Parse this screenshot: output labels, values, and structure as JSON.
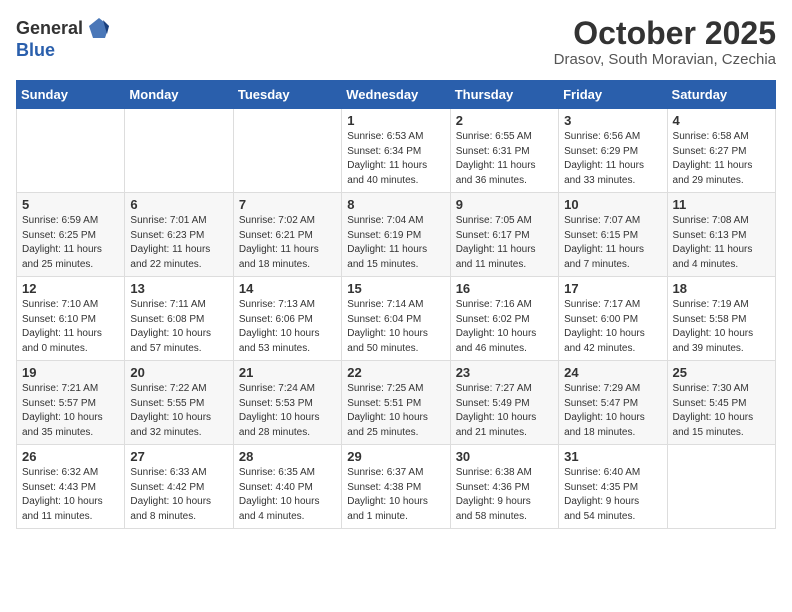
{
  "header": {
    "logo_general": "General",
    "logo_blue": "Blue",
    "month_title": "October 2025",
    "location": "Drasov, South Moravian, Czechia"
  },
  "weekdays": [
    "Sunday",
    "Monday",
    "Tuesday",
    "Wednesday",
    "Thursday",
    "Friday",
    "Saturday"
  ],
  "weeks": [
    [
      {
        "day": "",
        "info": ""
      },
      {
        "day": "",
        "info": ""
      },
      {
        "day": "",
        "info": ""
      },
      {
        "day": "1",
        "info": "Sunrise: 6:53 AM\nSunset: 6:34 PM\nDaylight: 11 hours\nand 40 minutes."
      },
      {
        "day": "2",
        "info": "Sunrise: 6:55 AM\nSunset: 6:31 PM\nDaylight: 11 hours\nand 36 minutes."
      },
      {
        "day": "3",
        "info": "Sunrise: 6:56 AM\nSunset: 6:29 PM\nDaylight: 11 hours\nand 33 minutes."
      },
      {
        "day": "4",
        "info": "Sunrise: 6:58 AM\nSunset: 6:27 PM\nDaylight: 11 hours\nand 29 minutes."
      }
    ],
    [
      {
        "day": "5",
        "info": "Sunrise: 6:59 AM\nSunset: 6:25 PM\nDaylight: 11 hours\nand 25 minutes."
      },
      {
        "day": "6",
        "info": "Sunrise: 7:01 AM\nSunset: 6:23 PM\nDaylight: 11 hours\nand 22 minutes."
      },
      {
        "day": "7",
        "info": "Sunrise: 7:02 AM\nSunset: 6:21 PM\nDaylight: 11 hours\nand 18 minutes."
      },
      {
        "day": "8",
        "info": "Sunrise: 7:04 AM\nSunset: 6:19 PM\nDaylight: 11 hours\nand 15 minutes."
      },
      {
        "day": "9",
        "info": "Sunrise: 7:05 AM\nSunset: 6:17 PM\nDaylight: 11 hours\nand 11 minutes."
      },
      {
        "day": "10",
        "info": "Sunrise: 7:07 AM\nSunset: 6:15 PM\nDaylight: 11 hours\nand 7 minutes."
      },
      {
        "day": "11",
        "info": "Sunrise: 7:08 AM\nSunset: 6:13 PM\nDaylight: 11 hours\nand 4 minutes."
      }
    ],
    [
      {
        "day": "12",
        "info": "Sunrise: 7:10 AM\nSunset: 6:10 PM\nDaylight: 11 hours\nand 0 minutes."
      },
      {
        "day": "13",
        "info": "Sunrise: 7:11 AM\nSunset: 6:08 PM\nDaylight: 10 hours\nand 57 minutes."
      },
      {
        "day": "14",
        "info": "Sunrise: 7:13 AM\nSunset: 6:06 PM\nDaylight: 10 hours\nand 53 minutes."
      },
      {
        "day": "15",
        "info": "Sunrise: 7:14 AM\nSunset: 6:04 PM\nDaylight: 10 hours\nand 50 minutes."
      },
      {
        "day": "16",
        "info": "Sunrise: 7:16 AM\nSunset: 6:02 PM\nDaylight: 10 hours\nand 46 minutes."
      },
      {
        "day": "17",
        "info": "Sunrise: 7:17 AM\nSunset: 6:00 PM\nDaylight: 10 hours\nand 42 minutes."
      },
      {
        "day": "18",
        "info": "Sunrise: 7:19 AM\nSunset: 5:58 PM\nDaylight: 10 hours\nand 39 minutes."
      }
    ],
    [
      {
        "day": "19",
        "info": "Sunrise: 7:21 AM\nSunset: 5:57 PM\nDaylight: 10 hours\nand 35 minutes."
      },
      {
        "day": "20",
        "info": "Sunrise: 7:22 AM\nSunset: 5:55 PM\nDaylight: 10 hours\nand 32 minutes."
      },
      {
        "day": "21",
        "info": "Sunrise: 7:24 AM\nSunset: 5:53 PM\nDaylight: 10 hours\nand 28 minutes."
      },
      {
        "day": "22",
        "info": "Sunrise: 7:25 AM\nSunset: 5:51 PM\nDaylight: 10 hours\nand 25 minutes."
      },
      {
        "day": "23",
        "info": "Sunrise: 7:27 AM\nSunset: 5:49 PM\nDaylight: 10 hours\nand 21 minutes."
      },
      {
        "day": "24",
        "info": "Sunrise: 7:29 AM\nSunset: 5:47 PM\nDaylight: 10 hours\nand 18 minutes."
      },
      {
        "day": "25",
        "info": "Sunrise: 7:30 AM\nSunset: 5:45 PM\nDaylight: 10 hours\nand 15 minutes."
      }
    ],
    [
      {
        "day": "26",
        "info": "Sunrise: 6:32 AM\nSunset: 4:43 PM\nDaylight: 10 hours\nand 11 minutes."
      },
      {
        "day": "27",
        "info": "Sunrise: 6:33 AM\nSunset: 4:42 PM\nDaylight: 10 hours\nand 8 minutes."
      },
      {
        "day": "28",
        "info": "Sunrise: 6:35 AM\nSunset: 4:40 PM\nDaylight: 10 hours\nand 4 minutes."
      },
      {
        "day": "29",
        "info": "Sunrise: 6:37 AM\nSunset: 4:38 PM\nDaylight: 10 hours\nand 1 minute."
      },
      {
        "day": "30",
        "info": "Sunrise: 6:38 AM\nSunset: 4:36 PM\nDaylight: 9 hours\nand 58 minutes."
      },
      {
        "day": "31",
        "info": "Sunrise: 6:40 AM\nSunset: 4:35 PM\nDaylight: 9 hours\nand 54 minutes."
      },
      {
        "day": "",
        "info": ""
      }
    ]
  ]
}
